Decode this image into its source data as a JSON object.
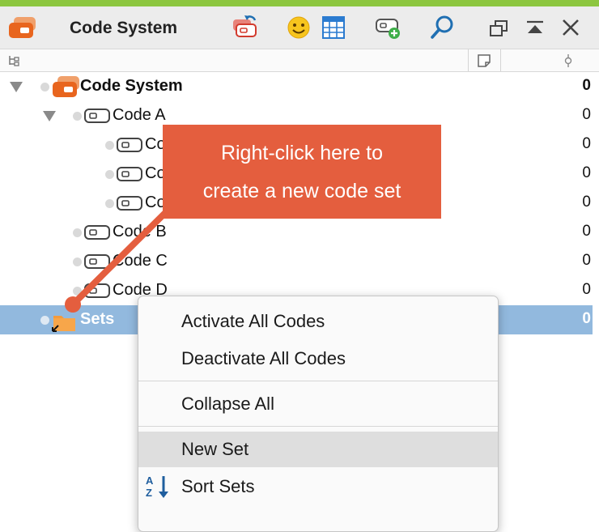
{
  "toolbar": {
    "title": "Code System",
    "icons": [
      "code-system-icon",
      "undo-code-icon",
      "smiley-icon",
      "table-icon",
      "new-code-icon",
      "search-icon",
      "undock-icon",
      "collapse-window-icon",
      "close-icon"
    ]
  },
  "column_header": {
    "icons": [
      "hierarchy-icon",
      "memo-icon",
      "frequency-icon"
    ]
  },
  "tree": {
    "rows": [
      {
        "label": "Code System",
        "count": "0"
      },
      {
        "label": "Code A",
        "count": "0"
      },
      {
        "label": "Code A.1",
        "count": "0"
      },
      {
        "label": "Code A.2",
        "count": "0"
      },
      {
        "label": "Code A.3",
        "count": "0"
      },
      {
        "label": "Code B",
        "count": "0"
      },
      {
        "label": "Code C",
        "count": "0"
      },
      {
        "label": "Code D",
        "count": "0"
      },
      {
        "label": "Sets",
        "count": "0"
      }
    ]
  },
  "callout": {
    "line1": "Right-click here to",
    "line2": "create a new code set",
    "color": "#e45e3e"
  },
  "context_menu": {
    "items": [
      {
        "label": "Activate All Codes"
      },
      {
        "label": "Deactivate All Codes"
      },
      {
        "label": "Collapse All"
      },
      {
        "label": "New Set",
        "highlighted": true
      },
      {
        "label": "Sort Sets",
        "icon": "sort-az-icon"
      }
    ]
  },
  "colors": {
    "accent_bar": "#8cc63f",
    "selection": "#92b9de",
    "code_system_orange": "#e8651e",
    "toolbar_blue": "#1f6fb2"
  }
}
